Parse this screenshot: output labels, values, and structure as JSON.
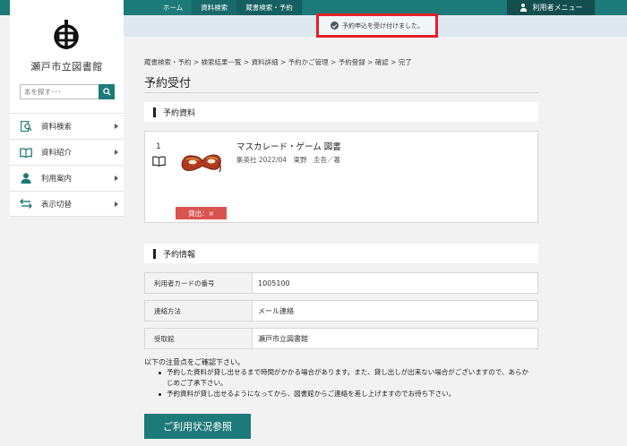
{
  "topbar": {
    "tabs": [
      "ホーム",
      "資料検索",
      "蔵書検索・予約"
    ],
    "user_menu": "利用者メニュー"
  },
  "sidebar": {
    "library_name": "瀬戸市立図書館",
    "search_placeholder": "本を探す･･･",
    "nav": [
      {
        "label": "資料検索",
        "icon": "search-book-icon"
      },
      {
        "label": "資料紹介",
        "icon": "open-book-icon"
      },
      {
        "label": "利用案内",
        "icon": "person-icon"
      },
      {
        "label": "表示切替",
        "icon": "switch-arrows-icon"
      }
    ]
  },
  "notice": "予約申込を受け付けました。",
  "breadcrumb": "蔵書検索・予約 > 検索結果一覧 > 資料詳細 > 予約かご管理 > 予約登録 > 確認 > 完了",
  "page_title": "予約受付",
  "reserved_section": {
    "heading": "予約資料",
    "item": {
      "number": "1",
      "title": "マスカレード・ゲーム 図書",
      "meta": "集英社 2022/04　東野　圭吾／著",
      "badge": "貸出：×"
    }
  },
  "info_section": {
    "heading": "予約情報",
    "rows": [
      {
        "label": "利用者カードの番号",
        "value": "1005100"
      },
      {
        "label": "連絡方法",
        "value": "メール連絡"
      },
      {
        "label": "受取館",
        "value": "瀬戸市立図書館"
      }
    ]
  },
  "notes": {
    "intro": "以下の注意点をご確認下さい。",
    "items": [
      "予約した資料が貸し出せるまで時間がかかる場合があります。また、貸し出しが出来ない場合がございますので、あらかじめご了承下さい。",
      "予約資料が貸し出せるようになってから、図書館からご連絡を差し上げますのでお待ち下さい。"
    ]
  },
  "status_button": "ご利用状況参照",
  "colors": {
    "accent": "#1c7a78",
    "alert": "#d9534f",
    "highlight_border": "#e3202a"
  }
}
